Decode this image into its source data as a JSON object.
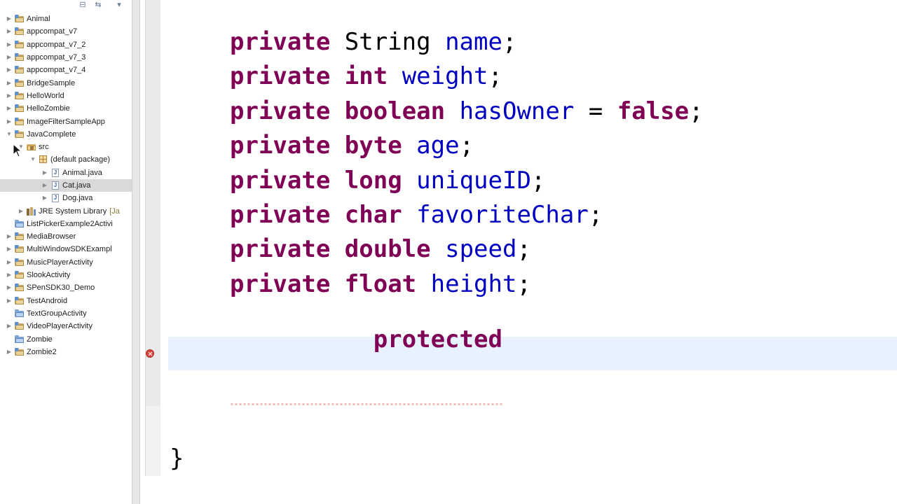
{
  "explorer": {
    "toolbar": {
      "collapse_icon": "collapse-all-icon",
      "link_icon": "link-with-editor-icon",
      "menu_icon": "view-menu-icon"
    },
    "items": [
      {
        "label": "Animal",
        "depth": 0,
        "expander": "collapsed",
        "icon": "project"
      },
      {
        "label": "appcompat_v7",
        "depth": 0,
        "expander": "collapsed",
        "icon": "project"
      },
      {
        "label": "appcompat_v7_2",
        "depth": 0,
        "expander": "collapsed",
        "icon": "project"
      },
      {
        "label": "appcompat_v7_3",
        "depth": 0,
        "expander": "collapsed",
        "icon": "project"
      },
      {
        "label": "appcompat_v7_4",
        "depth": 0,
        "expander": "collapsed",
        "icon": "project"
      },
      {
        "label": "BridgeSample",
        "depth": 0,
        "expander": "collapsed",
        "icon": "project"
      },
      {
        "label": "HelloWorld",
        "depth": 0,
        "expander": "collapsed",
        "icon": "project"
      },
      {
        "label": "HelloZombie",
        "depth": 0,
        "expander": "collapsed",
        "icon": "project"
      },
      {
        "label": "ImageFilterSampleApp",
        "depth": 0,
        "expander": "collapsed",
        "icon": "project"
      },
      {
        "label": "JavaComplete",
        "depth": 0,
        "expander": "expanded",
        "icon": "project"
      },
      {
        "label": "src",
        "depth": 1,
        "expander": "expanded",
        "icon": "src"
      },
      {
        "label": "(default package)",
        "depth": 2,
        "expander": "expanded",
        "icon": "package"
      },
      {
        "label": "Animal.java",
        "depth": 3,
        "expander": "collapsed",
        "icon": "java"
      },
      {
        "label": "Cat.java",
        "depth": 3,
        "expander": "collapsed",
        "icon": "java",
        "selected": true
      },
      {
        "label": "Dog.java",
        "depth": 3,
        "expander": "collapsed",
        "icon": "java"
      },
      {
        "label": "JRE System Library",
        "suffix": "[Ja",
        "depth": 1,
        "expander": "collapsed",
        "icon": "library"
      },
      {
        "label": "ListPickerExample2Activi",
        "depth": 0,
        "expander": "none",
        "icon": "folder"
      },
      {
        "label": "MediaBrowser",
        "depth": 0,
        "expander": "collapsed",
        "icon": "project"
      },
      {
        "label": "MultiWindowSDKExampl",
        "depth": 0,
        "expander": "collapsed",
        "icon": "project"
      },
      {
        "label": "MusicPlayerActivity",
        "depth": 0,
        "expander": "collapsed",
        "icon": "project"
      },
      {
        "label": "SlookActivity",
        "depth": 0,
        "expander": "collapsed",
        "icon": "project"
      },
      {
        "label": "SPenSDK30_Demo",
        "depth": 0,
        "expander": "collapsed",
        "icon": "project"
      },
      {
        "label": "TestAndroid",
        "depth": 0,
        "expander": "collapsed",
        "icon": "project"
      },
      {
        "label": "TextGroupActivity",
        "depth": 0,
        "expander": "none",
        "icon": "folder"
      },
      {
        "label": "VideoPlayerActivity",
        "depth": 0,
        "expander": "collapsed",
        "icon": "project"
      },
      {
        "label": "Zombie",
        "depth": 0,
        "expander": "none",
        "icon": "folder"
      },
      {
        "label": "Zombie2",
        "depth": 0,
        "expander": "collapsed",
        "icon": "project"
      }
    ]
  },
  "editor": {
    "lines": [
      [
        {
          "t": "private",
          "k": "kw"
        },
        {
          "t": " String ",
          "k": "plain"
        },
        {
          "t": "name",
          "k": "field"
        },
        {
          "t": ";",
          "k": "plain"
        }
      ],
      [
        {
          "t": "private",
          "k": "kw"
        },
        {
          "t": " ",
          "k": "plain"
        },
        {
          "t": "int",
          "k": "kw"
        },
        {
          "t": " ",
          "k": "plain"
        },
        {
          "t": "weight",
          "k": "field"
        },
        {
          "t": ";",
          "k": "plain"
        }
      ],
      [
        {
          "t": "private",
          "k": "kw"
        },
        {
          "t": " ",
          "k": "plain"
        },
        {
          "t": "boolean",
          "k": "kw"
        },
        {
          "t": " ",
          "k": "plain"
        },
        {
          "t": "hasOwner",
          "k": "field"
        },
        {
          "t": " = ",
          "k": "plain"
        },
        {
          "t": "false",
          "k": "kw"
        },
        {
          "t": ";",
          "k": "plain"
        }
      ],
      [
        {
          "t": "private",
          "k": "kw"
        },
        {
          "t": " ",
          "k": "plain"
        },
        {
          "t": "byte",
          "k": "kw"
        },
        {
          "t": " ",
          "k": "plain"
        },
        {
          "t": "age",
          "k": "field"
        },
        {
          "t": ";",
          "k": "plain"
        }
      ],
      [
        {
          "t": "private",
          "k": "kw"
        },
        {
          "t": " ",
          "k": "plain"
        },
        {
          "t": "long",
          "k": "kw"
        },
        {
          "t": " ",
          "k": "plain"
        },
        {
          "t": "uniqueID",
          "k": "field"
        },
        {
          "t": ";",
          "k": "plain"
        }
      ],
      [
        {
          "t": "private",
          "k": "kw"
        },
        {
          "t": " ",
          "k": "plain"
        },
        {
          "t": "char",
          "k": "kw"
        },
        {
          "t": " ",
          "k": "plain"
        },
        {
          "t": "favoriteChar",
          "k": "field"
        },
        {
          "t": ";",
          "k": "plain"
        }
      ],
      [
        {
          "t": "private",
          "k": "kw"
        },
        {
          "t": " ",
          "k": "plain"
        },
        {
          "t": "double",
          "k": "kw"
        },
        {
          "t": " ",
          "k": "plain"
        },
        {
          "t": "speed",
          "k": "field"
        },
        {
          "t": ";",
          "k": "plain"
        }
      ],
      [
        {
          "t": "private",
          "k": "kw"
        },
        {
          "t": " ",
          "k": "plain"
        },
        {
          "t": "float",
          "k": "kw"
        },
        {
          "t": " ",
          "k": "plain"
        },
        {
          "t": "height",
          "k": "field"
        },
        {
          "t": ";",
          "k": "plain"
        }
      ]
    ],
    "current_line_text": "protected",
    "closing_brace": "}",
    "error_icon": "error-marker-icon"
  },
  "colors": {
    "keyword": "#7f0055",
    "field": "#0000c0",
    "current_line": "#e8f2fe",
    "error": "#d9453d",
    "selection": "#d9d9d9"
  }
}
